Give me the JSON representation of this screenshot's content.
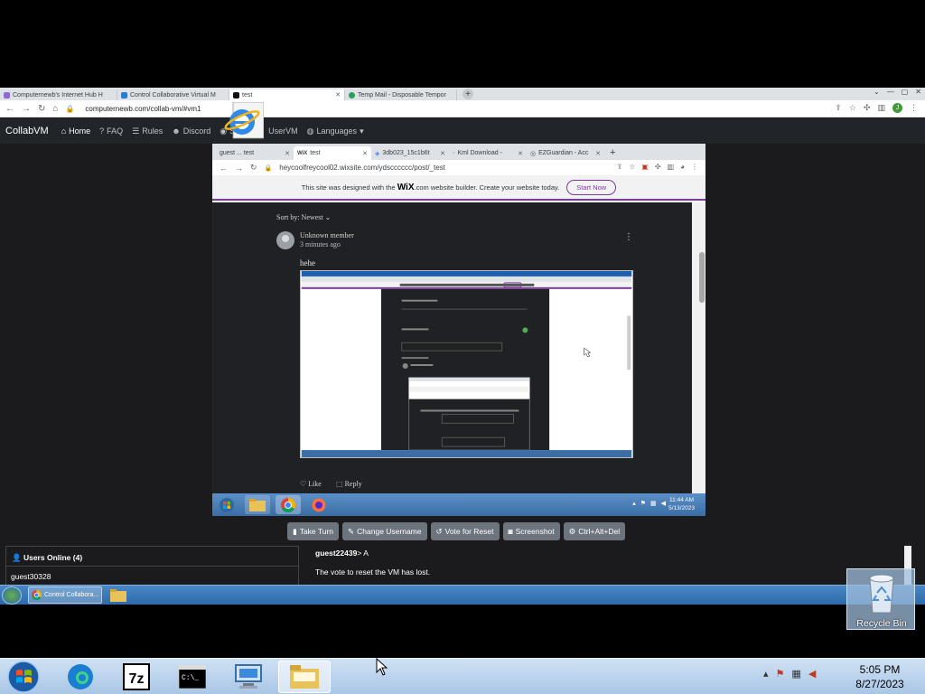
{
  "outer_browser": {
    "tabs": [
      {
        "label": "Computernewb's Internet Hub H",
        "active": false
      },
      {
        "label": "Control Collaborative Virtual M",
        "active": false
      },
      {
        "label": "test",
        "active": true
      },
      {
        "label": "Temp Mail - Disposable Tempor",
        "active": false
      }
    ],
    "url": "computernewb.com/collab-vm/#vm1",
    "profile_initial": "J"
  },
  "collabvm_nav": {
    "brand": "CollabVM",
    "items": [
      {
        "label": "Home",
        "icon": "home-icon"
      },
      {
        "label": "FAQ",
        "icon": "question-icon"
      },
      {
        "label": "Rules",
        "icon": "rules-icon"
      },
      {
        "label": "Discord",
        "icon": "discord-icon"
      },
      {
        "label": "Subr",
        "icon": "reddit-icon"
      },
      {
        "label": "UserVM",
        "icon": "user-icon"
      },
      {
        "label": "Languages",
        "icon": "globe-icon"
      }
    ]
  },
  "inner_browser": {
    "tabs": [
      {
        "label": "guest ... test",
        "active": false
      },
      {
        "label": "test",
        "active": true
      },
      {
        "label": "3db023_15c1b6t",
        "active": false
      },
      {
        "label": "Kml Download -",
        "active": false
      },
      {
        "label": "EZGuardian - Acc",
        "active": false
      }
    ],
    "url": "heycoolfreycool02.wixsite.com/ydscccccc/post/_test",
    "wix_banner_pre": "This site was designed with the",
    "wix_logo": "WiX",
    "wix_banner_post": ".com website builder. Create your website today.",
    "wix_cta": "Start Now"
  },
  "post": {
    "sort_label": "Sort by: Newest",
    "author": "Unknown member",
    "time": "3 minutes ago",
    "text": "hehe",
    "like_label": "Like",
    "reply_label": "Reply"
  },
  "inner_taskbar": {
    "time": "11:44 AM",
    "date": "5/13/2023"
  },
  "collabvm_controls": {
    "buttons": [
      {
        "label": "Take Turn",
        "icon": "hand-icon"
      },
      {
        "label": "Change Username",
        "icon": "user-edit-icon"
      },
      {
        "label": "Vote for Reset",
        "icon": "reset-icon"
      },
      {
        "label": "Screenshot",
        "icon": "camera-icon"
      },
      {
        "label": "Ctrl+Alt+Del",
        "icon": "gear-icon"
      }
    ]
  },
  "users": {
    "title": "Users Online (4)",
    "list": [
      "guest30328"
    ]
  },
  "chat": {
    "messages": [
      {
        "user": "guest22439",
        "sep": ">",
        "text": "A"
      },
      {
        "user": "",
        "sep": "",
        "text": "The vote to reset the VM has lost."
      }
    ]
  },
  "vm_taskbar": {
    "chrome_label": "Control Collabora..."
  },
  "desktop": {
    "recycle_bin_label": "Recycle Bin"
  },
  "host_taskbar": {
    "time": "5:05 PM",
    "date": "8/27/2023"
  },
  "colors": {
    "cvm_nav_bg": "#212529",
    "cvm_button": "#6c757d",
    "wix_accent": "#7b3b9b",
    "page_dark": "#202124"
  }
}
